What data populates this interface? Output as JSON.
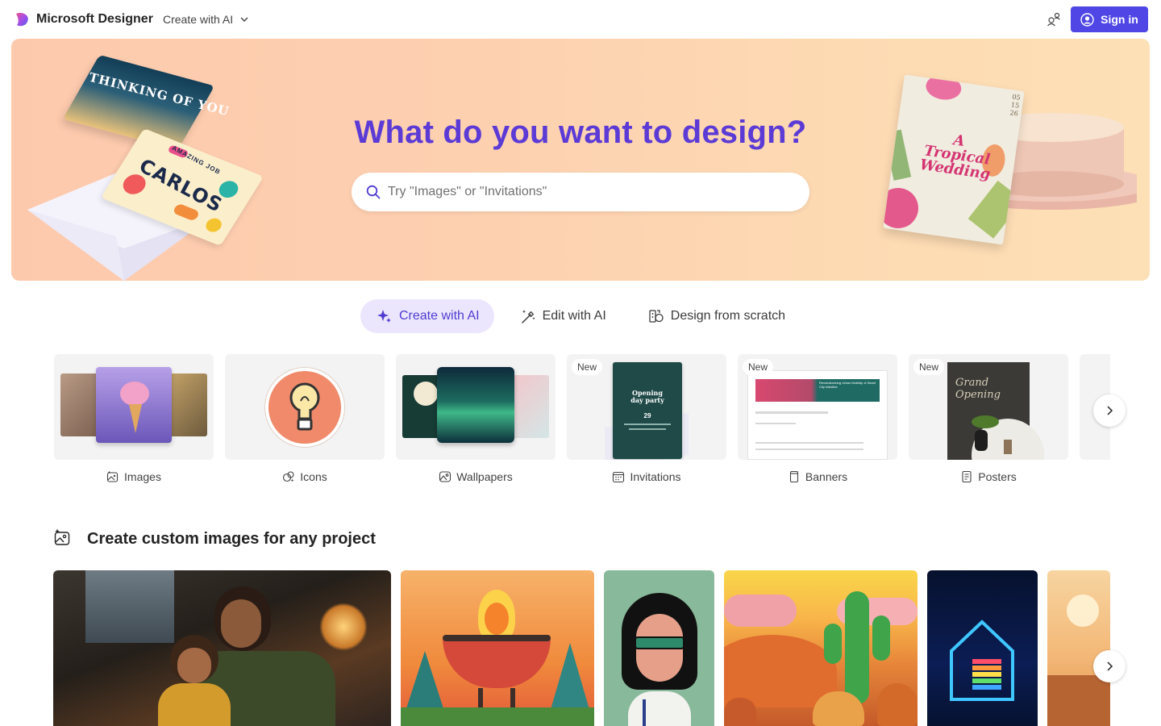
{
  "header": {
    "app_name": "Microsoft Designer",
    "menu_label": "Create with AI",
    "signin_label": "Sign in"
  },
  "hero": {
    "title": "What do you want to design?",
    "search_placeholder": "Try \"Images\" or \"Invitations\"",
    "search_value": "",
    "card1_text": "THINKING OF YOU",
    "card2_top": "AMAZING JOB",
    "card2_text": "CARLOS",
    "wedding_text": "A Tropical Wedding",
    "wedding_date": "05 15 26"
  },
  "tabs": [
    {
      "label": "Create with AI",
      "active": true
    },
    {
      "label": "Edit with AI",
      "active": false
    },
    {
      "label": "Design from scratch",
      "active": false
    }
  ],
  "categories": [
    {
      "label": "Images",
      "badge": ""
    },
    {
      "label": "Icons",
      "badge": ""
    },
    {
      "label": "Wallpapers",
      "badge": ""
    },
    {
      "label": "Invitations",
      "badge": "New",
      "thumb_title": "Opening day party",
      "thumb_date": "29"
    },
    {
      "label": "Banners",
      "badge": "New",
      "thumb_title": "Revolutionizing Urban Mobility: A Smart City Initiative"
    },
    {
      "label": "Posters",
      "badge": "New",
      "thumb_title": "Grand Opening"
    }
  ],
  "section": {
    "title": "Create custom images for any project"
  },
  "colors": {
    "accent": "#4f46e5",
    "hero_title": "#5b3ad6",
    "active_tab_bg": "#ebe6fd"
  }
}
